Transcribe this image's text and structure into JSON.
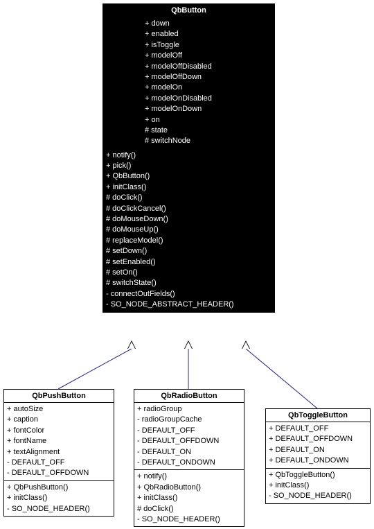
{
  "base": {
    "name": "QbButton",
    "attrs": [
      "+ down",
      "+ enabled",
      "+ isToggle",
      "+ modelOff",
      "+ modelOffDisabled",
      "+ modelOffDown",
      "+ modelOn",
      "+ modelOnDisabled",
      "+ modelOnDown",
      "+ on",
      "# state",
      "# switchNode"
    ],
    "ops": [
      "+ notify()",
      "+ pick()",
      "+ QbButton()",
      "+ initClass()",
      "# doClick()",
      "# doClickCancel()",
      "# doMouseDown()",
      "# doMouseUp()",
      "# replaceModel()",
      "# setDown()",
      "# setEnabled()",
      "# setOn()",
      "# switchState()",
      "- connectOutFields()",
      "- SO_NODE_ABSTRACT_HEADER()"
    ]
  },
  "push": {
    "name": "QbPushButton",
    "attrs": [
      "+ autoSize",
      "+ caption",
      "+ fontColor",
      "+ fontName",
      "+ textAlignment",
      "- DEFAULT_OFF",
      "- DEFAULT_OFFDOWN"
    ],
    "ops": [
      "+ QbPushButton()",
      "+ initClass()",
      "- SO_NODE_HEADER()"
    ]
  },
  "radio": {
    "name": "QbRadioButton",
    "attrs": [
      "+ radioGroup",
      "- radioGroupCache",
      "- DEFAULT_OFF",
      "- DEFAULT_OFFDOWN",
      "- DEFAULT_ON",
      "- DEFAULT_ONDOWN"
    ],
    "ops": [
      "+ notify()",
      "+ QbRadioButton()",
      "+ initClass()",
      "# doClick()",
      "- SO_NODE_HEADER()"
    ]
  },
  "toggle": {
    "name": "QbToggleButton",
    "attrs": [
      "+ DEFAULT_OFF",
      "+ DEFAULT_OFFDOWN",
      "+ DEFAULT_ON",
      "+ DEFAULT_ONDOWN"
    ],
    "ops": [
      "+ QbToggleButton()",
      "+ initClass()",
      "- SO_NODE_HEADER()"
    ]
  }
}
